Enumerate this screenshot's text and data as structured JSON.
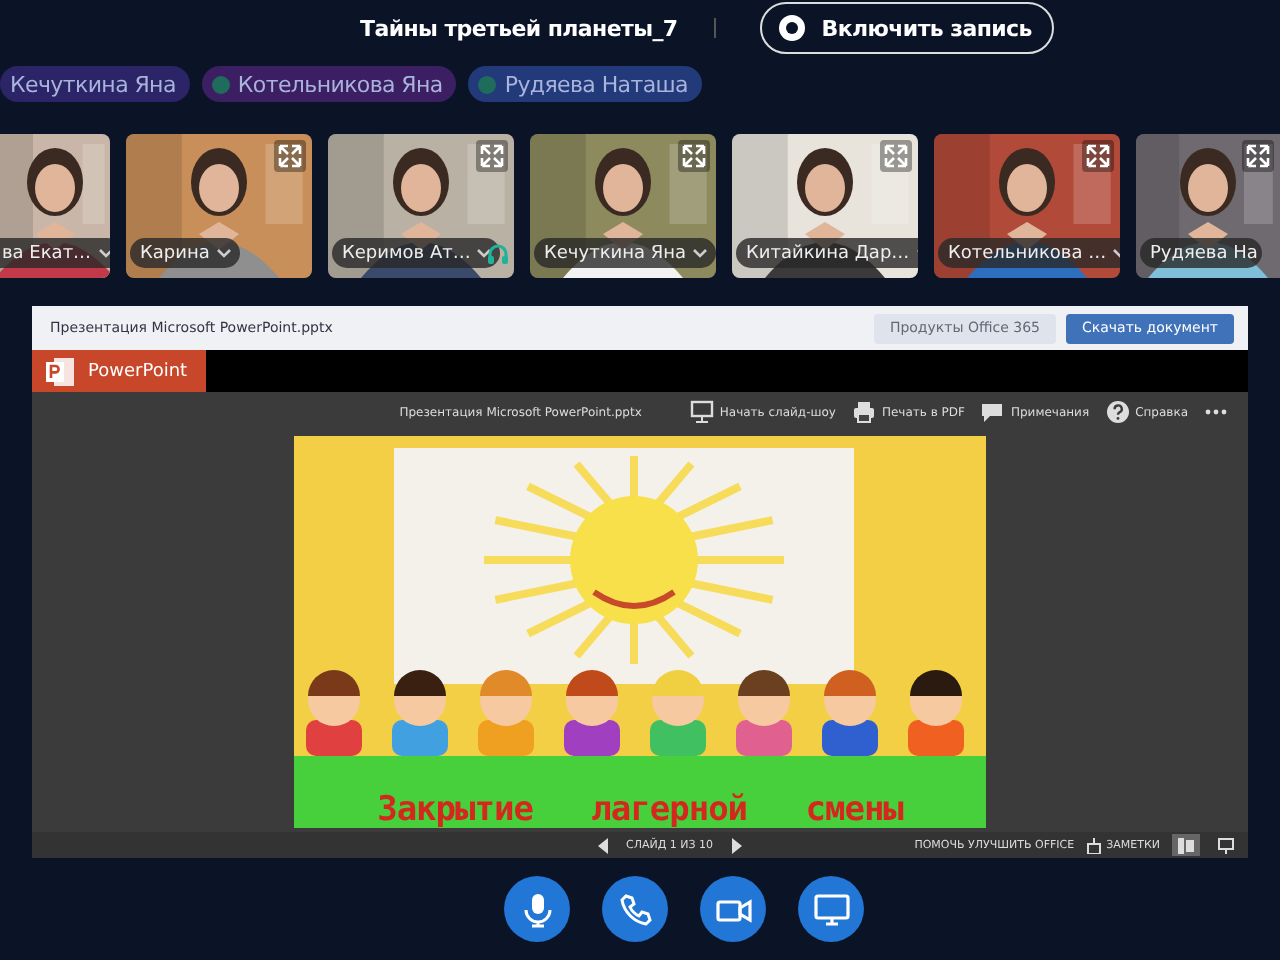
{
  "meeting": {
    "title": "Тайны третьей планеты_7",
    "record_button": "Включить запись"
  },
  "chips": [
    {
      "name": "Кечуткина Яна",
      "color": "#2b2466",
      "dot": false
    },
    {
      "name": "Котельникова Яна",
      "color": "#3b1f62",
      "dot": true
    },
    {
      "name": "Рудяева Наташа",
      "color": "#223a7a",
      "dot": true
    }
  ],
  "tiles": [
    {
      "name": "ва Екат…",
      "kind": "cut-left",
      "headphones": false
    },
    {
      "name": "Карина",
      "kind": "full",
      "headphones": false
    },
    {
      "name": "Керимов Ат…",
      "kind": "full",
      "headphones": true
    },
    {
      "name": "Кечуткина Яна",
      "kind": "full",
      "headphones": false
    },
    {
      "name": "Китайкина Дар…",
      "kind": "full",
      "headphones": false
    },
    {
      "name": "Котельникова …",
      "kind": "full",
      "headphones": false
    },
    {
      "name": "Рудяева На",
      "kind": "cut-right",
      "headphones": false
    }
  ],
  "document": {
    "filename": "Презентация Microsoft PowerPoint.pptx",
    "buttons": [
      {
        "label": "Продукты Office 365",
        "kind": "secondary"
      },
      {
        "label": "Скачать документ",
        "kind": "primary"
      }
    ],
    "app": "PowerPoint",
    "toolbar": {
      "filename": "Презентация Microsoft PowerPoint.pptx",
      "actions": [
        {
          "label": "Начать слайд-шоу",
          "kind": "slideshow"
        },
        {
          "label": "Печать в PDF",
          "kind": "print"
        },
        {
          "label": "Примечания",
          "kind": "comments"
        },
        {
          "label": "Справка",
          "kind": "help"
        },
        {
          "kind": "more"
        }
      ]
    },
    "slide": {
      "caption": "Закрытие   лагерной   смены"
    },
    "status": {
      "counter": "СЛАЙД 1 ИЗ 10",
      "help": "ПОМОЧЬ УЛУЧШИТЬ OFFICE",
      "notes": "ЗАМЕТКИ"
    }
  },
  "controls": [
    {
      "kind": "mic"
    },
    {
      "kind": "phone"
    },
    {
      "kind": "camera"
    },
    {
      "kind": "screen"
    }
  ]
}
